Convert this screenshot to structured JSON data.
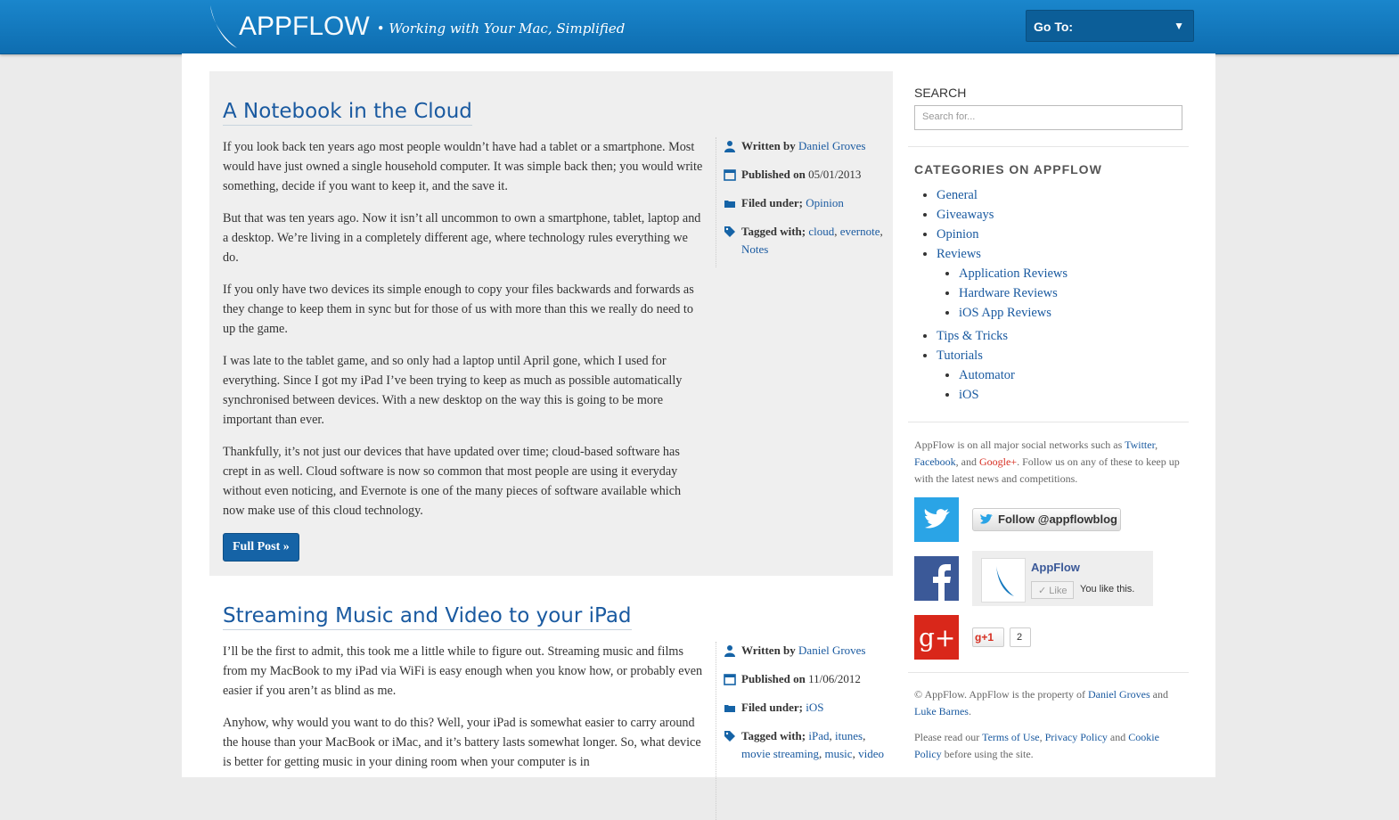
{
  "header": {
    "logo_app": "APP",
    "logo_flow": "FLOW",
    "tagline": "• Working with Your Mac, Simplified",
    "goto_label": "Go To:",
    "goto_caret": "▼"
  },
  "posts": [
    {
      "title": "A Notebook in the Cloud",
      "paragraphs": [
        "If you look back ten years ago most people wouldn’t have had a tablet or a smartphone. Most would have just owned a single household computer. It was simple back then; you would write something, decide if you want to keep it, and the save it.",
        "But that was ten years ago. Now it isn’t all uncommon to own a smartphone, tablet, laptop and a desktop. We’re living in a completely different age, where technology rules everything we do.",
        "If you only have two devices its simple enough to copy your files backwards and forwards as they change to keep them in sync but for those of us with more than this we really do need to up the game.",
        "I was late to the tablet game, and so only had a laptop until April gone, which I used for everything. Since I got my iPad I’ve been trying to keep as much as possible automatically synchronised between devices. With a new desktop on the way this is going to be more important than ever.",
        "Thankfully, it’s not just our devices that have updated over time; cloud-based software has crept in as well. Cloud software is now so common that most people are using it everyday without even noticing, and Evernote is one of the many pieces of software available which now make use of this cloud technology."
      ],
      "button": "Full Post »",
      "meta": {
        "written_label": "Written by",
        "author": "Daniel Groves",
        "published_label": "Published on",
        "date": "05/01/2013",
        "filed_label": "Filed under;",
        "category": "Opinion",
        "tagged_label": "Tagged with;",
        "tags": [
          "cloud",
          "evernote",
          "Notes"
        ]
      }
    },
    {
      "title": "Streaming Music and Video to your iPad",
      "paragraphs": [
        "I’ll be the first to admit, this took me a little while to figure out. Streaming music and films from my MacBook to my iPad via WiFi is easy enough when you know how, or probably even easier if you aren’t as blind as me.",
        "Anyhow, why would you want to do this? Well, your iPad is somewhat easier to carry around the house than your MacBook or iMac, and it’s battery lasts somewhat longer. So, what device is better for getting music in your dining room when your computer is in"
      ],
      "meta": {
        "written_label": "Written by",
        "author": "Daniel Groves",
        "published_label": "Published on",
        "date": "11/06/2012",
        "filed_label": "Filed under;",
        "category": "iOS",
        "tagged_label": "Tagged with;",
        "tags": [
          "iPad",
          "itunes",
          "movie streaming",
          "music",
          "video"
        ]
      }
    }
  ],
  "sidebar": {
    "search_title": "SEARCH",
    "search_placeholder": "Search for...",
    "categories_title": "CATEGORIES ON APPFLOW",
    "categories": {
      "general": "General",
      "giveaways": "Giveaways",
      "opinion": "Opinion",
      "reviews": "Reviews",
      "application_reviews": "Application Reviews",
      "hardware_reviews": "Hardware Reviews",
      "ios_app_reviews": "iOS App Reviews",
      "tips": "Tips & Tricks",
      "tutorials": "Tutorials",
      "automator": "Automator",
      "ios": "iOS"
    },
    "social": {
      "intro_1": "AppFlow is on all major social networks such as",
      "twitter": "Twitter",
      "facebook": "Facebook",
      "and": ", and",
      "gplus": "Google+",
      "intro_2": ". Follow us on any of these to keep up with the latest news and competitions.",
      "follow_button": "Follow @appflowblog",
      "fb_page": "AppFlow",
      "fb_like": "Like",
      "fb_liked": "You like this.",
      "gp_button": "+1",
      "gp_count": "2"
    },
    "footer": {
      "copyright_1": "© AppFlow. AppFlow is the property of",
      "owner1": "Daniel Groves",
      "and": "and",
      "owner2": "Luke Barnes",
      "read_1": "Please read our",
      "terms": "Terms of Use",
      "privacy": "Privacy Policy",
      "and2": "and",
      "cookie": "Cookie Policy",
      "read_2": "before using the site."
    }
  },
  "colors": {
    "header_blue": "#1478be",
    "link_blue": "#1a5aa0",
    "button_blue": "#1563a6",
    "twitter": "#2aa4e6",
    "facebook": "#3b5998",
    "gplus": "#d9271a"
  }
}
